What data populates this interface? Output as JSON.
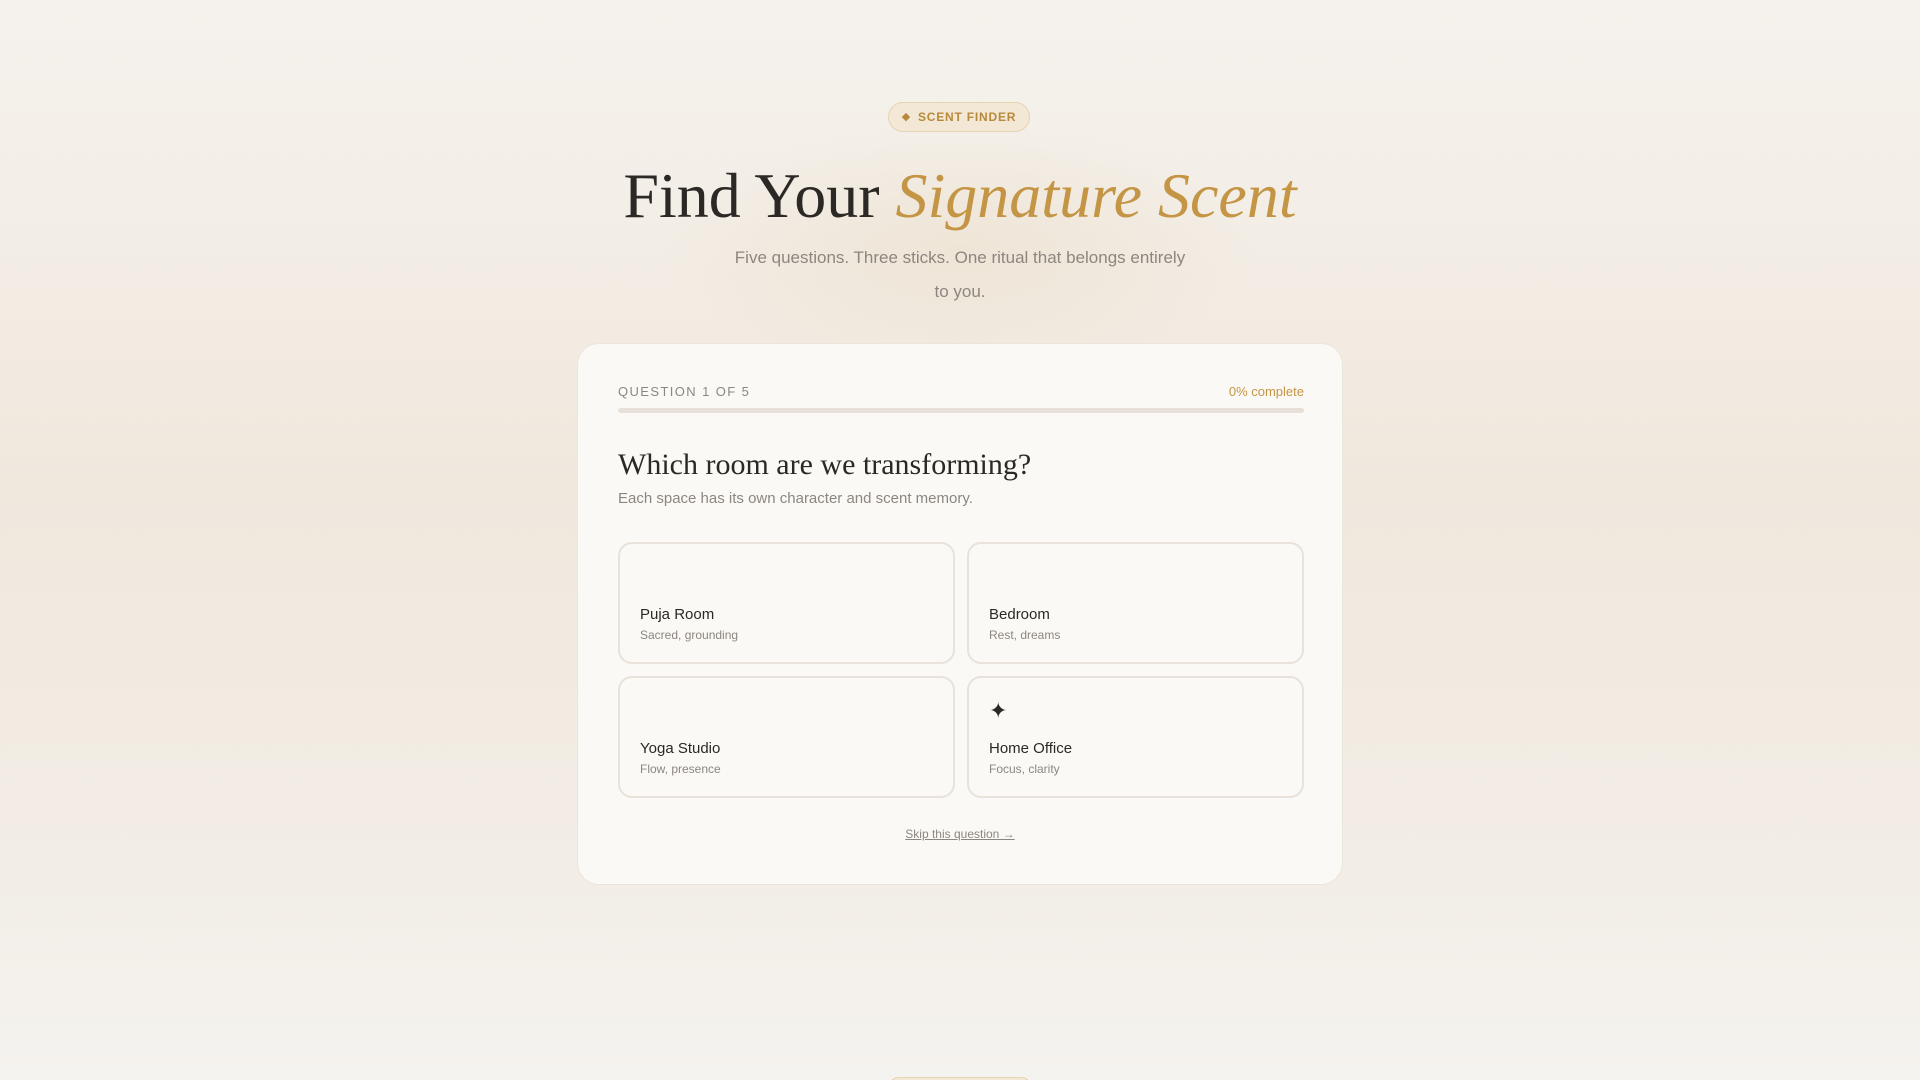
{
  "hero": {
    "badge_icon": "◆",
    "badge": "SCENT FINDER",
    "title_plain": "Find Your ",
    "title_accent": "Signature Scent",
    "subtitle": "Five questions. Three sticks. One ritual that belongs entirely to you."
  },
  "quiz": {
    "question_counter": "QUESTION 1 OF 5",
    "percent_label": "0% complete",
    "progress": 0,
    "question": "Which room are we transforming?",
    "hint": "Each space has its own character and scent memory.",
    "options": [
      {
        "title": "Puja Room",
        "desc": "Sacred, grounding",
        "icon": ""
      },
      {
        "title": "Bedroom",
        "desc": "Rest, dreams",
        "icon": ""
      },
      {
        "title": "Yoga Studio",
        "desc": "Flow, presence",
        "icon": ""
      },
      {
        "title": "Home Office",
        "desc": "Focus, clarity",
        "icon": "✦"
      }
    ],
    "skip": "Skip this question →"
  },
  "colors": {
    "accent": "#c49544",
    "text": "#2b2825",
    "muted": "#8c867f",
    "card": "#fbf9f5",
    "badge_bg": "#f3e8d6"
  }
}
